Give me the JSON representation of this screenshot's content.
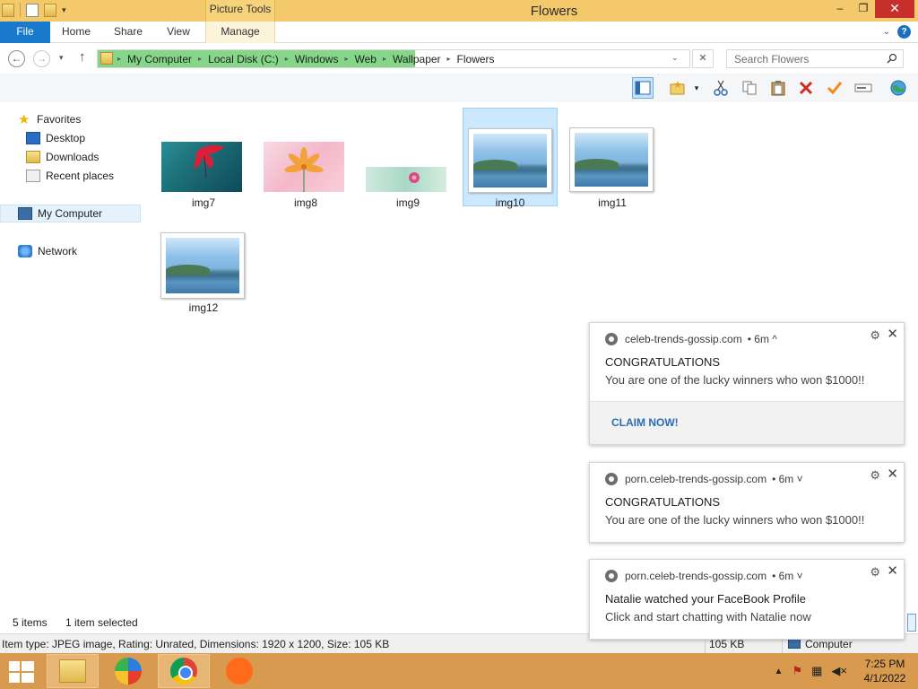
{
  "window": {
    "title": "Flowers",
    "contextual_tab_group": "Picture Tools",
    "controls": {
      "minimize": "‒",
      "maximize": "❐",
      "close": "✕"
    }
  },
  "ribbon": {
    "tabs": [
      "File",
      "Home",
      "Share",
      "View",
      "Manage"
    ],
    "help": "?"
  },
  "address": {
    "breadcrumbs": [
      "My Computer",
      "Local Disk (C:)",
      "Windows",
      "Web",
      "Wallpaper",
      "Flowers"
    ],
    "search_placeholder": "Search Flowers"
  },
  "toolbar": {
    "icons": [
      "layout-pane-icon",
      "new-folder-icon",
      "cut-icon",
      "copy-icon",
      "paste-icon",
      "delete-icon",
      "checkmark-icon",
      "rename-icon",
      "globe-icon"
    ]
  },
  "nav": {
    "favorites": "Favorites",
    "desktop": "Desktop",
    "downloads": "Downloads",
    "recent": "Recent places",
    "computer": "My Computer",
    "network": "Network"
  },
  "files": [
    {
      "name": "img7",
      "selected": false
    },
    {
      "name": "img8",
      "selected": false
    },
    {
      "name": "img9",
      "selected": false
    },
    {
      "name": "img10",
      "selected": true
    },
    {
      "name": "img11",
      "selected": false
    },
    {
      "name": "img12",
      "selected": false
    }
  ],
  "status": {
    "items": "5 items",
    "selected": "1 item selected",
    "details": "Item type: JPEG image, Rating: Unrated, Dimensions: 1920 x 1200, Size: 105 KB",
    "size": "105 KB",
    "location": "Computer"
  },
  "notifications": [
    {
      "source": "celeb-trends-gossip.com",
      "time": "• 6m ^",
      "title": "CONGRATULATIONS",
      "body": "You are one of the lucky winners who won $1000!!",
      "action": "CLAIM NOW!"
    },
    {
      "source": "porn.celeb-trends-gossip.com",
      "time": "• 6m ˅",
      "title": "CONGRATULATIONS",
      "body": "You are one of the lucky winners who won $1000!!"
    },
    {
      "source": "porn.celeb-trends-gossip.com",
      "time": "• 6m ˅",
      "title": "Natalie watched your FaceBook Profile",
      "body": "Click and start chatting with Natalie now"
    }
  ],
  "taskbar": {
    "apps": [
      "file-explorer-icon",
      "alpha-browser-icon",
      "chrome-icon",
      "sublime-text-icon"
    ],
    "clock_time": "7:25 PM",
    "clock_date": "4/1/2022"
  },
  "colors": {
    "file_tab": "#1979ca",
    "titlebar": "#f4c96b",
    "taskbar": "#d89a4e",
    "breadcrumb_highlight": "#86d68a",
    "selection": "#cce8ff",
    "link": "#2a6db5"
  }
}
